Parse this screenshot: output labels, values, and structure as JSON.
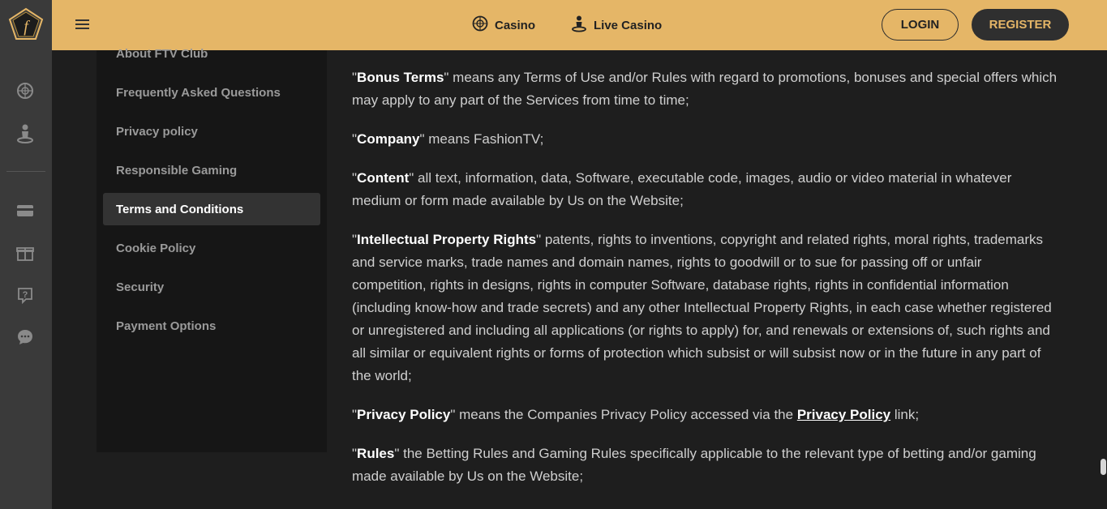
{
  "header": {
    "nav": [
      {
        "label": "Casino",
        "icon": "roulette-icon"
      },
      {
        "label": "Live Casino",
        "icon": "dealer-icon"
      }
    ],
    "login_label": "LOGIN",
    "register_label": "REGISTER"
  },
  "sidebar": {
    "items": [
      {
        "label": "About FTV Club"
      },
      {
        "label": "Frequently Asked Questions"
      },
      {
        "label": "Privacy policy"
      },
      {
        "label": "Responsible Gaming"
      },
      {
        "label": "Terms and Conditions",
        "active": true
      },
      {
        "label": "Cookie Policy"
      },
      {
        "label": "Security"
      },
      {
        "label": "Payment Options"
      }
    ]
  },
  "terms": {
    "bonus": {
      "term": "Bonus Terms",
      "text": "\" means any Terms of Use and/or Rules with regard to promotions, bonuses and special offers which may apply to any part of the Services from time to time;"
    },
    "company": {
      "term": "Company",
      "text": "\" means FashionTV;"
    },
    "content": {
      "term": "Content",
      "text": "\" all text, information, data, Software, executable code, images, audio or video material in whatever medium or form made available by Us on the Website;"
    },
    "ipr": {
      "term": "Intellectual Property Rights",
      "text": "\" patents, rights to inventions, copyright and related rights, moral rights, trademarks and service marks, trade names and domain names, rights to goodwill or to sue for passing off or unfair competition, rights in designs, rights in computer Software, database rights, rights in confidential information (including know-how and trade secrets) and any other Intellectual Property Rights, in each case whether registered or unregistered and including all applications (or rights to apply) for, and renewals or extensions of, such rights and all similar or equivalent rights or forms of protection which subsist or will subsist now or in the future in any part of the world;"
    },
    "privacy": {
      "term": "Privacy Policy",
      "text": "\" means the Companies Privacy Policy accessed via the ",
      "link": "Privacy Policy",
      "tail": " link;"
    },
    "rules": {
      "term": "Rules",
      "text": "\" the Betting Rules and Gaming Rules specifically applicable to the relevant type of betting and/or gaming made available by Us on the Website;"
    }
  },
  "colors": {
    "accent": "#e5b667",
    "rail": "#3a3a3a",
    "background": "#1e1e1e"
  }
}
